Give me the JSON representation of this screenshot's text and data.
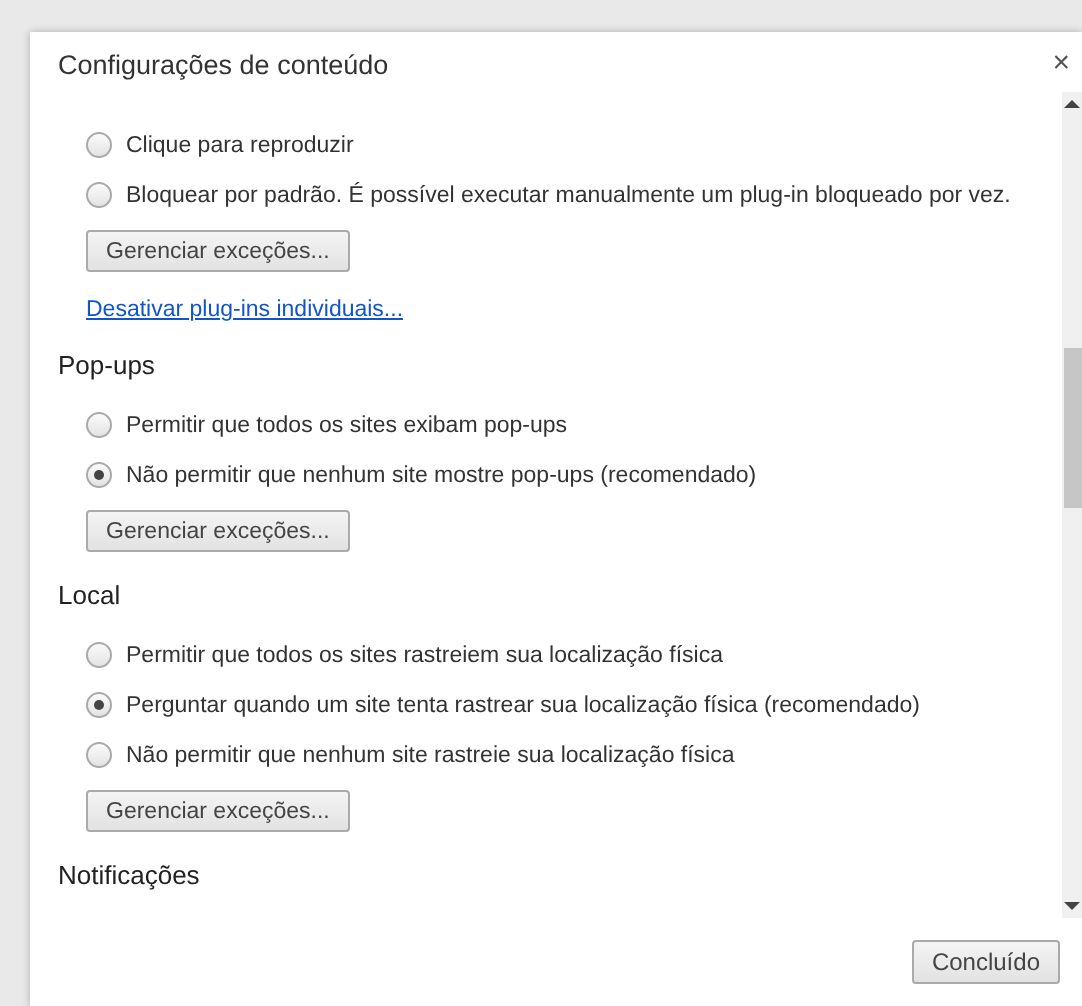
{
  "dialog": {
    "title": "Configurações de conteúdo",
    "close": "×",
    "sections": [
      {
        "options": [
          {
            "label": "Clique para reproduzir",
            "selected": false
          },
          {
            "label": "Bloquear por padrão. É possível executar manualmente um plug-in bloqueado por vez.",
            "selected": false
          }
        ],
        "button": "Gerenciar exceções...",
        "link": "Desativar plug-ins individuais..."
      },
      {
        "heading": "Pop-ups",
        "options": [
          {
            "label": "Permitir que todos os sites exibam pop-ups",
            "selected": false
          },
          {
            "label": "Não permitir que nenhum site mostre pop-ups (recomendado)",
            "selected": true
          }
        ],
        "button": "Gerenciar exceções..."
      },
      {
        "heading": "Local",
        "options": [
          {
            "label": "Permitir que todos os sites rastreiem sua localização física",
            "selected": false
          },
          {
            "label": "Perguntar quando um site tenta rastrear sua localização física (recomendado)",
            "selected": true
          },
          {
            "label": "Não permitir que nenhum site rastreie sua localização física",
            "selected": false
          }
        ],
        "button": "Gerenciar exceções..."
      },
      {
        "heading": "Notificações"
      }
    ],
    "done_button": "Concluído"
  }
}
